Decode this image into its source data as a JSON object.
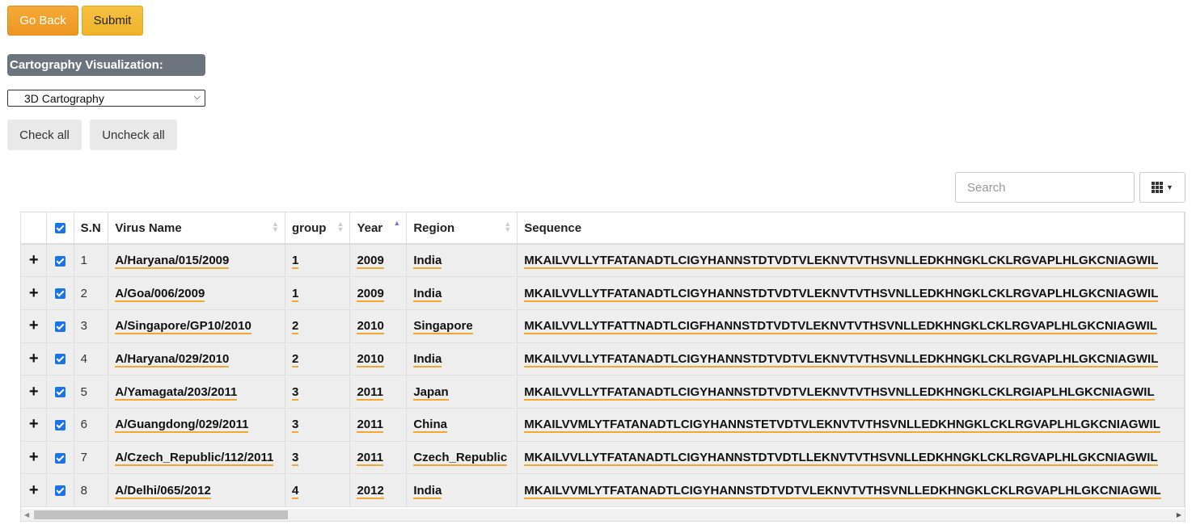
{
  "buttons": {
    "go_back": "Go Back",
    "submit": "Submit",
    "check_all": "Check all",
    "uncheck_all": "Uncheck all"
  },
  "visualization": {
    "label": "Cartography Visualization:",
    "selected": "3D Cartography"
  },
  "search": {
    "placeholder": "Search"
  },
  "table": {
    "headers": [
      "S.N",
      "Virus Name",
      "group",
      "Year",
      "Region",
      "Sequence"
    ],
    "sorted_column": "Year",
    "rows": [
      {
        "sn": "1",
        "name": "A/Haryana/015/2009",
        "group": "1",
        "year": "2009",
        "region": "India",
        "seq": "MKAILVVLLYTFATANADTLCIGYHANNSTDTVDTVLEKNVTVTHSVNLLEDKHNGKLCKLRGVAPLHLGKCNIAGWIL"
      },
      {
        "sn": "2",
        "name": "A/Goa/006/2009",
        "group": "1",
        "year": "2009",
        "region": "India",
        "seq": "MKAILVVLLYTFATANADTLCIGYHANNSTDTVDTVLEKNVTVTHSVNLLEDKHNGKLCKLRGVAPLHLGKCNIAGWIL"
      },
      {
        "sn": "3",
        "name": "A/Singapore/GP10/2010",
        "group": "2",
        "year": "2010",
        "region": "Singapore",
        "seq": "MKAILVVLLYTFATTNADTLCIGFHANNSTDTVDTVLEKNVTVTHSVNLLEDKHNGKLCKLRGVAPLHLGKCNIAGWIL"
      },
      {
        "sn": "4",
        "name": "A/Haryana/029/2010",
        "group": "2",
        "year": "2010",
        "region": "India",
        "seq": "MKAILVVLLYTFATANADTLCIGYHANNSTDTVDTVLEKNVTVTHSVNLLEDKHNGKLCKLRGVAPLHLGKCNIAGWIL"
      },
      {
        "sn": "5",
        "name": "A/Yamagata/203/2011",
        "group": "3",
        "year": "2011",
        "region": "Japan",
        "seq": "MKAILVVLLYTFATANADTLCIGYHANNSTDTVDTVLEKNVTVTHSVNLLEDKHNGKLCKLRGIAPLHLGKCNIAGWIL"
      },
      {
        "sn": "6",
        "name": "A/Guangdong/029/2011",
        "group": "3",
        "year": "2011",
        "region": "China",
        "seq": "MKAILVVMLYTFATANADTLCIGYHANNSTETVDTVLEKNVTVTHSVNLLEDKHNGKLCKLRGVAPLHLGKCNIAGWIL"
      },
      {
        "sn": "7",
        "name": "A/Czech_Republic/112/2011",
        "group": "3",
        "year": "2011",
        "region": "Czech_Republic",
        "seq": "MKAILVVLLYTFATANADTLCIGYHANNSTDTVDTLLEKNVTVTHSVNLLEDKHNGKLCKLRGVAPLHLGKCNIAGWIL"
      },
      {
        "sn": "8",
        "name": "A/Delhi/065/2012",
        "group": "4",
        "year": "2012",
        "region": "India",
        "seq": "MKAILVVMLYTFATANADTLCIGYHANNSTDTVDTVLEKNVTVTHSVNLLEDKHNGKLCKLRGVAPLHLGKCNIAGWIL"
      }
    ]
  }
}
